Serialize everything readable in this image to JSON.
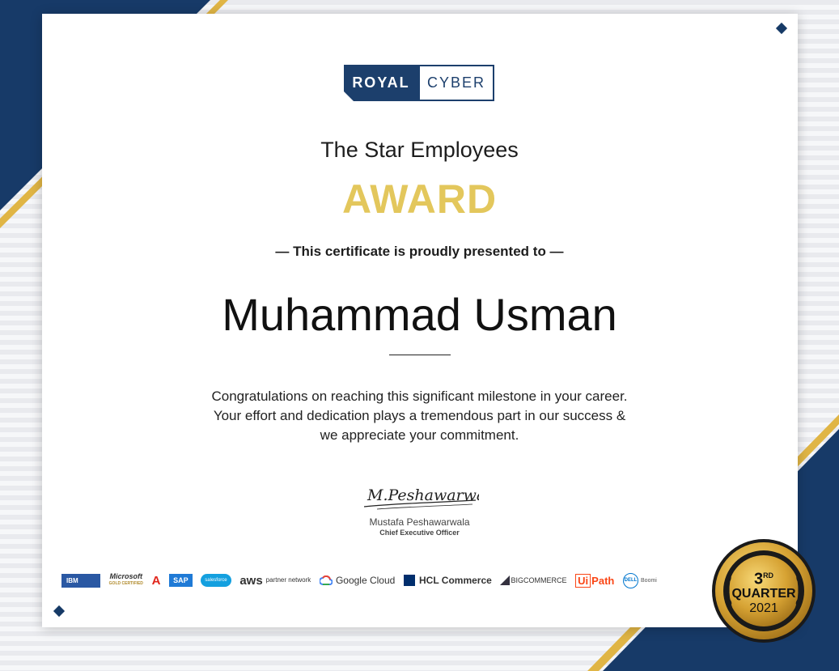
{
  "certificate": {
    "title": "The Star Employees",
    "award": "AWARD",
    "presented_to": "— This certificate is proudly presented to —",
    "recipient": "Muhammad Usman",
    "message": [
      "Congratulations on reaching this significant milestone in your career.",
      "Your effort and dedication plays a tremendous part in our success &",
      "we appreciate your commitment."
    ],
    "signature_text": "M.Peshawarwala",
    "signer_name": "Mustafa Peshawarwala",
    "signer_title": "Chief Executive Officer"
  },
  "logo": {
    "left": "ROYAL",
    "right": "CYBER"
  },
  "partners": {
    "ibm": "IBM",
    "microsoft": "Microsoft",
    "microsoft_tag": "GOLD CERTIFIED",
    "adobe": "A",
    "sap": "SAP",
    "salesforce": "salesforce",
    "aws": "aws",
    "aws_tag": "partner network",
    "google": "Google Cloud",
    "hcl": "HCL Commerce",
    "bigcommerce": "BIGCOMMERCE",
    "uipath_a": "Ui",
    "uipath_b": "Path",
    "dell": "DELL",
    "boomi": "Boomi"
  },
  "seal": {
    "ordinal": "3",
    "ordinal_suffix": "RD",
    "label": "QUARTER",
    "year": "2021"
  },
  "colors": {
    "navy": "#163a66",
    "gold": "#e3c75c",
    "accent_gold": "#d4a23a"
  }
}
